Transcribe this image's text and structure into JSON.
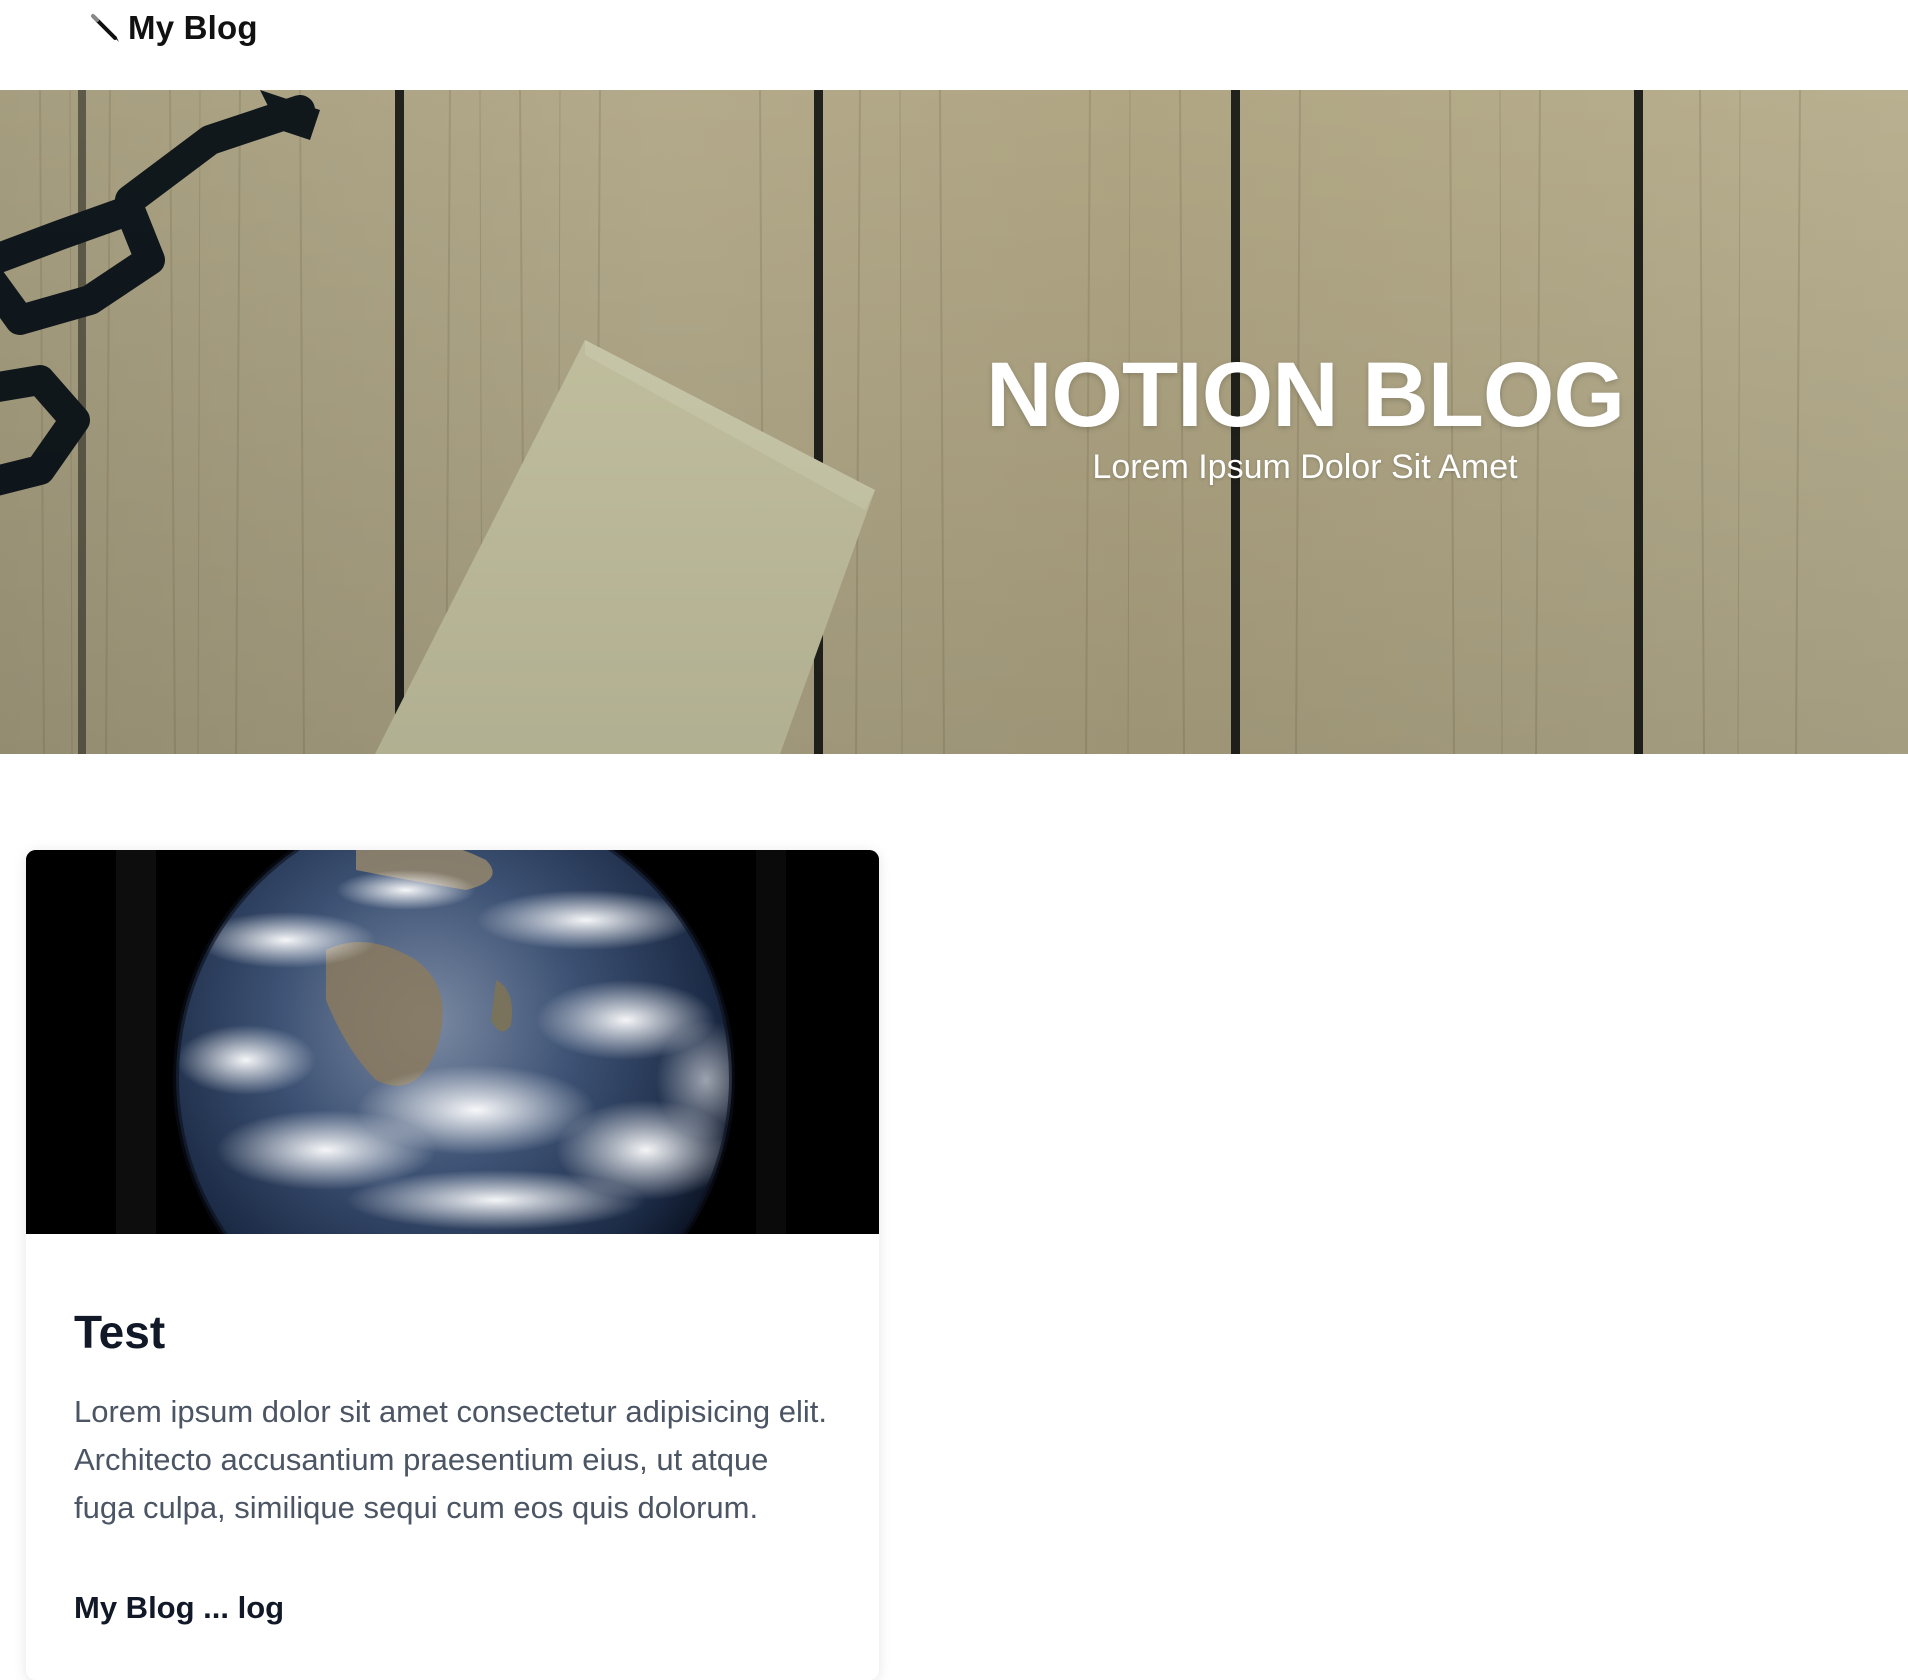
{
  "nav": {
    "brand_label": "My Blog",
    "brand_icon": "pen-icon"
  },
  "hero": {
    "title": "NOTION BLOG",
    "subtitle": "Lorem Ipsum Dolor Sit Amet",
    "background": "wooden-desk-photo-with-glasses-and-paper",
    "text_color": "#ffffff"
  },
  "posts": [
    {
      "image": "earth-from-space-photo",
      "title": "Test",
      "description": "Lorem ipsum dolor sit amet consectetur adipisicing elit. Architecto accusantium praesentium eius, ut atque fuga culpa, similique sequi cum eos quis dolorum.",
      "meta": "My Blog ... log"
    }
  ],
  "colors": {
    "page_background": "#ffffff",
    "brand_text": "#111111",
    "card_title": "#111827",
    "card_text": "#4b5563"
  }
}
